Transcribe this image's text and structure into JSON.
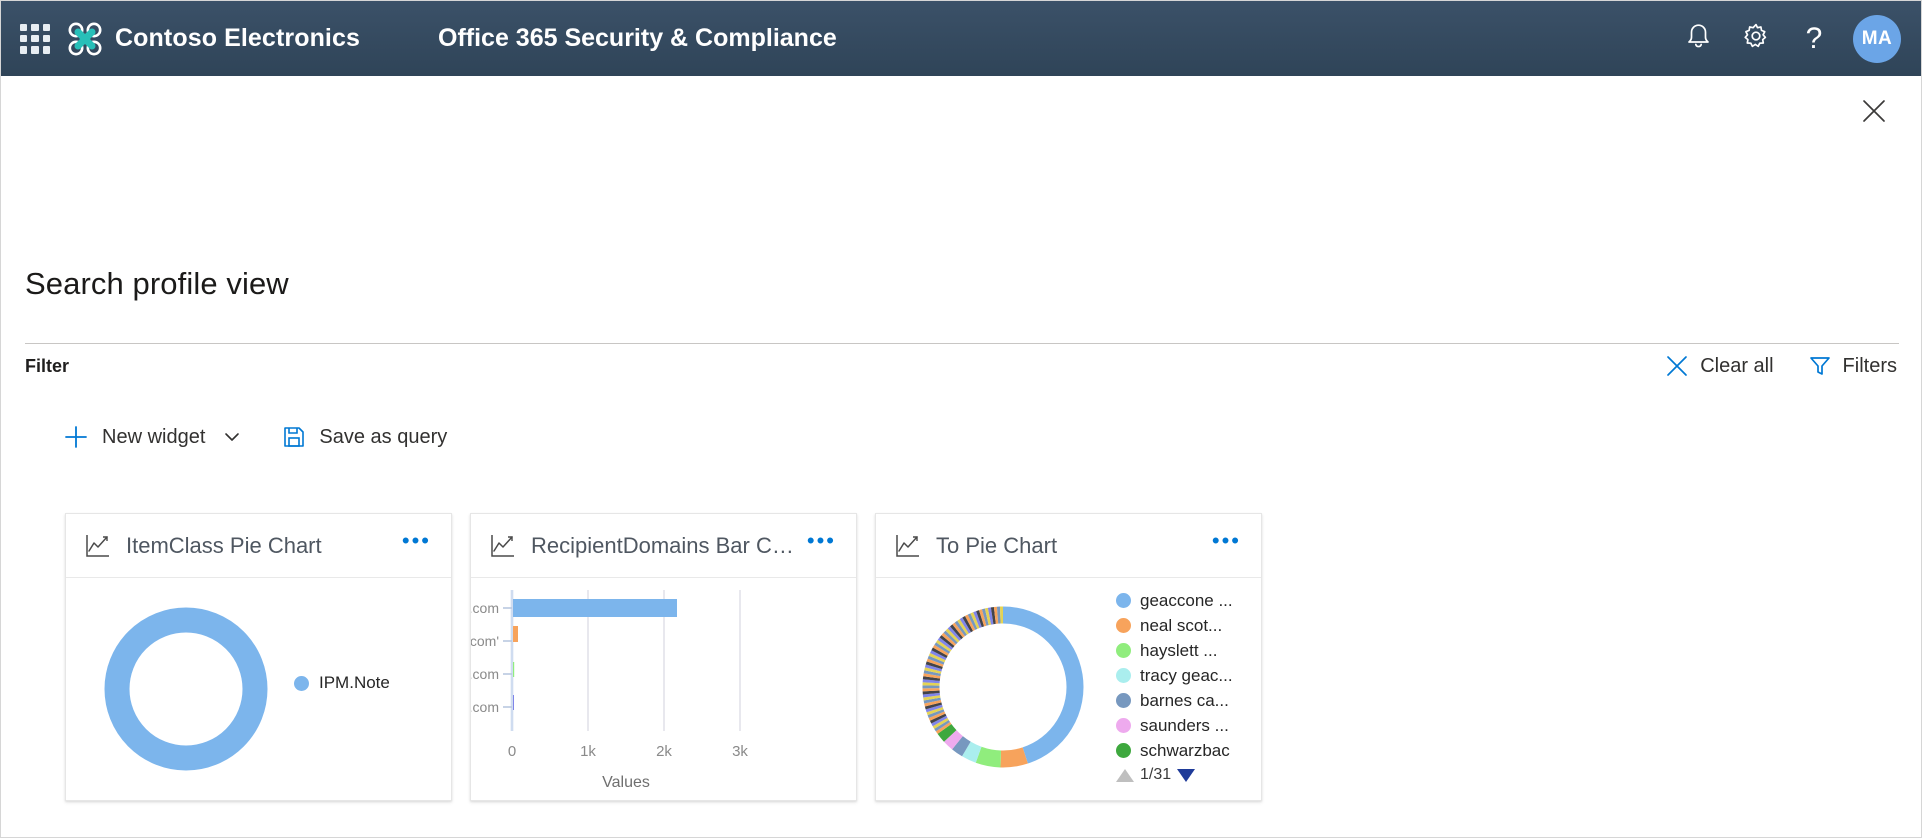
{
  "suite_header": {
    "waffle_label": "app-launcher",
    "org_name": "Contoso Electronics",
    "app_title": "Office 365 Security & Compliance",
    "notifications_icon": "bell-icon",
    "settings_icon": "gear-icon",
    "help_icon": "help-icon",
    "help_glyph": "?",
    "avatar_initials": "MA",
    "colors": {
      "header_bg": "#30465c",
      "avatar_bg": "#6ba5e7",
      "logo_accent": "#27bfb8"
    }
  },
  "panel": {
    "close_icon": "close-icon",
    "page_title": "Search profile view",
    "filter_label": "Filter",
    "actions": [
      {
        "label": "Clear all",
        "icon": "clear-icon"
      },
      {
        "label": "Filters",
        "icon": "filter-funnel-icon"
      }
    ],
    "commandbar": [
      {
        "label": "New widget",
        "icon": "plus-icon",
        "has_chevron": true
      },
      {
        "label": "Save as query",
        "icon": "save-icon",
        "has_chevron": false
      }
    ]
  },
  "cards": [
    {
      "title": "ItemClass Pie Chart",
      "icon": "line-chart-icon",
      "more_label": "•••"
    },
    {
      "title": "RecipientDomains Bar Chart",
      "icon": "line-chart-icon",
      "more_label": "•••"
    },
    {
      "title": "To Pie Chart",
      "icon": "line-chart-icon",
      "more_label": "•••"
    }
  ],
  "chart_data": [
    {
      "type": "pie",
      "title": "ItemClass Pie Chart",
      "variant": "donut",
      "legend_position": "right",
      "labels": [
        "IPM.Note"
      ],
      "values": [
        100
      ],
      "colors": [
        "#7cb5ec"
      ]
    },
    {
      "type": "bar",
      "title": "RecipientDomains Bar Chart",
      "orientation": "horizontal",
      "categories": [
        "enron.com",
        "enron.com'",
        "adaytum.com",
        "adaytum-msp.com"
      ],
      "values": [
        2150,
        35,
        2,
        1
      ],
      "colors": [
        "#7cb5ec",
        "#f7a35c",
        "#90ed7d",
        "#8085e9"
      ],
      "xlabel": "Values",
      "ylabel": "",
      "xlim": [
        0,
        3300
      ],
      "xticks": [
        0,
        1000,
        2000,
        3000
      ],
      "xticklabels": [
        "0",
        "1k",
        "2k",
        "3k"
      ],
      "grid": true,
      "legend_position": "none"
    },
    {
      "type": "pie",
      "title": "To Pie Chart",
      "variant": "donut",
      "legend_position": "right",
      "legend_page": "1/31",
      "legend_page_current": 1,
      "legend_page_total": 31,
      "labels": [
        "geaccone ...",
        "neal scot...",
        "hayslett ...",
        "tracy geac...",
        "barnes ca...",
        "saunders ...",
        "schwarzbac"
      ],
      "values": [
        45.0,
        5.5,
        5.0,
        3.0,
        2.4,
        2.2,
        2.0
      ],
      "colors": [
        "#7cb5ec",
        "#f7a35c",
        "#90ed7d",
        "#aaeeee",
        "#7798bf",
        "#eeaaee",
        "#3ea83e"
      ],
      "other_slices_note": "remaining ~35% split across many tiny multi-colored segments"
    }
  ]
}
